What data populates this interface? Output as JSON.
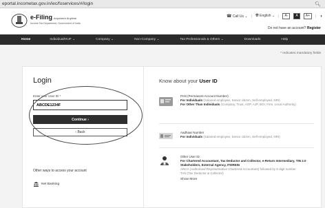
{
  "browser": {
    "url": "eportal.incometax.gov.in/iec/foservices/#/login"
  },
  "header": {
    "brand": "e-Filing",
    "brand_hindi": "Anywhere Anytime",
    "tagline": "Income Tax Department, Government of India",
    "call_us": "Call Us",
    "language": "English",
    "font_decrease": "A-",
    "font_default": "A",
    "font_increase": "A+",
    "no_account": "Do not have an account?",
    "register": "Register"
  },
  "nav": {
    "items": [
      "Home",
      "Individual/HUF",
      "Company",
      "Non-Company",
      "Tax Professionals & Others",
      "Downloads",
      "Help"
    ]
  },
  "mandatory_note": "* Indicates mandatory fields",
  "login": {
    "title": "Login",
    "uid_label": "Enter your User ID *",
    "uid_value": "ABCDE1234F",
    "continue_label": "Continue",
    "back_label": "Back",
    "other_ways": "Other ways to access your account",
    "net_banking": "Net Banking"
  },
  "know": {
    "title_prefix": "Know about your",
    "title_bold": "User ID",
    "pan": {
      "heading": "PAN (Permanent Account Number)",
      "line1_bold": "For Individuals",
      "line1_rest": "(Salaried employee, Senior citizen, Self-employed, NRI)",
      "line2_bold": "For Other Than Individuals",
      "line2_rest": "(Company, Trust, AOP, AJP, BOI, Firm, Local Authority)"
    },
    "aadhaar": {
      "heading": "Aadhaar Number",
      "line1_bold": "For Individuals",
      "line1_rest": "(Salaried employee, Senior citizen, Self-employed, NRI)"
    },
    "other": {
      "heading": "Other User ID",
      "line1_bold": "For Chartered Accountant, Tax Deductor and Collector, e-Return Intermediary, TIN 2.0 Stakeholders, External Agency, ITDREIN",
      "line2": "ARCA (Authorised Representative Chartered Accountant) followed by 6 digit number",
      "line3": "TAN (Tax Deductor & Collector)",
      "show_more": "Show More"
    }
  }
}
